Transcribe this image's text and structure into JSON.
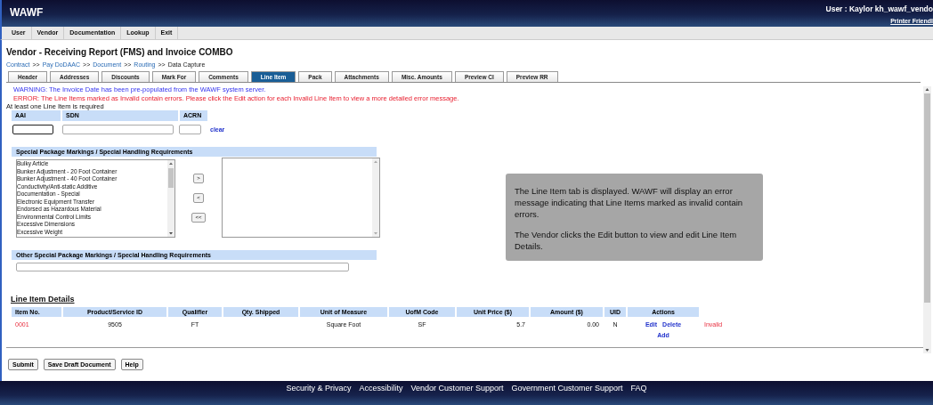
{
  "header": {
    "logo": "WAWF",
    "user": "User : Kaylor kh_wawf_vendo",
    "printer_link": "Printer Friendl"
  },
  "menu": [
    "User",
    "Vendor",
    "Documentation",
    "Lookup",
    "Exit"
  ],
  "page_title": "Vendor - Receiving Report (FMS) and Invoice COMBO",
  "breadcrumb": [
    {
      "label": "Contract",
      "link": true
    },
    {
      "label": ">>",
      "link": false
    },
    {
      "label": "Pay DoDAAC",
      "link": true
    },
    {
      "label": ">>",
      "link": false
    },
    {
      "label": "Document",
      "link": true
    },
    {
      "label": ">>",
      "link": false
    },
    {
      "label": "Routing",
      "link": true
    },
    {
      "label": ">>",
      "link": false
    },
    {
      "label": "Data Capture",
      "link": false
    }
  ],
  "tabs": [
    {
      "label": "Header",
      "selected": false
    },
    {
      "label": "Addresses",
      "selected": false
    },
    {
      "label": "Discounts",
      "selected": false
    },
    {
      "label": "Mark For",
      "selected": false
    },
    {
      "label": "Comments",
      "selected": false
    },
    {
      "label": "Line Item",
      "selected": true
    },
    {
      "label": "Pack",
      "selected": false
    },
    {
      "label": "Attachments",
      "selected": false
    },
    {
      "label": "Misc. Amounts",
      "selected": false
    },
    {
      "label": "Preview CI",
      "selected": false
    },
    {
      "label": "Preview RR",
      "selected": false
    }
  ],
  "messages": [
    {
      "kind": "warning",
      "text": "WARNING: The Invoice Date has been pre-populated from the WAWF system server."
    },
    {
      "kind": "error",
      "text": "ERROR: The Line Items marked as Invalid contain errors. Please click the Edit action for each Invalid Line Item to view a more detailed error message."
    },
    {
      "kind": "note",
      "text": "At least one Line Item is required"
    }
  ],
  "aai_fields": {
    "labels": [
      "AAI",
      "SDN",
      "ACRN"
    ],
    "clear_link": "clear"
  },
  "special_markings": {
    "title": "Special Package Markings / Special Handling Requirements",
    "options": [
      "Bulky Article",
      "Bunker Adjustment - 20 Foot Container",
      "Bunker Adjustment - 40 Foot Container",
      "Conductivity/Anti-static Additive",
      "Documentation - Special",
      "Electronic Equipment Transfer",
      "Endorsed as Hazardous Material",
      "Environmental Control Limits",
      "Excessive Dimensions",
      "Excessive Weight"
    ],
    "buttons": [
      ">",
      "<",
      "<<"
    ]
  },
  "other_markings": {
    "title": "Other Special Package Markings / Special Handling Requirements"
  },
  "line_items": {
    "title": "Line Item Details",
    "columns": [
      "Item No.",
      "Product/Service ID",
      "Qualifier",
      "Qty. Shipped",
      "Unit of Measure",
      "UofM Code",
      "Unit Price ($)",
      "Amount ($)",
      "UID",
      "Actions"
    ],
    "rows": [
      {
        "item_no": "0001",
        "product_id": "9505",
        "qualifier": "FT",
        "unit": "Square Foot",
        "uofm_code": "SF",
        "unit_price": "5.7",
        "amount": "0.00",
        "uid": "N",
        "actions": [
          "Edit",
          "Delete"
        ],
        "add": "Add",
        "status": "Invalid",
        "invalid": true
      }
    ]
  },
  "buttons": [
    "Submit",
    "Save Draft Document",
    "Help"
  ],
  "footer_links": [
    "Security & Privacy",
    "Accessibility",
    "Vendor Customer Support",
    "Government Customer Support",
    "FAQ"
  ],
  "callout": [
    "The Line Item tab is displayed. WAWF will display an error message indicating that Line Items marked as invalid contain errors.",
    "The Vendor clicks the Edit button to view and edit Line Item Details."
  ]
}
